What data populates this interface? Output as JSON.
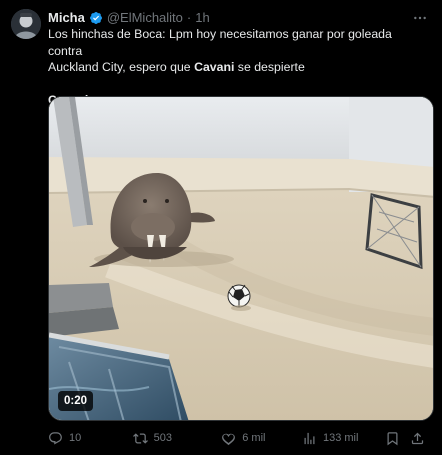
{
  "author": {
    "display_name": "Micha",
    "handle": "@ElMichalito",
    "separator": "·",
    "time": "1h",
    "verified_color": "#1d9bf0"
  },
  "tweet": {
    "line1_prefix": "Los hinchas de Boca: Lpm hoy necesitamos ganar por goleada contra",
    "line2_prefix": "Auckland City, espero que ",
    "line2_bold": "Cavani",
    "line2_suffix": " se despierte",
    "line3_bold": "Cavani:"
  },
  "media": {
    "duration": "0:20"
  },
  "actions": {
    "reply_count": "10",
    "retweet_count": "503",
    "like_count": "6 mil",
    "views_count": "133 mil"
  },
  "colors": {
    "background": "#000000",
    "text": "#e7e9ea",
    "muted": "#71767b",
    "accent": "#1d9bf0"
  },
  "icons": [
    "more-icon",
    "verified-icon",
    "reply-icon",
    "retweet-icon",
    "like-icon",
    "views-icon",
    "bookmark-icon",
    "share-icon",
    "play-duration"
  ]
}
